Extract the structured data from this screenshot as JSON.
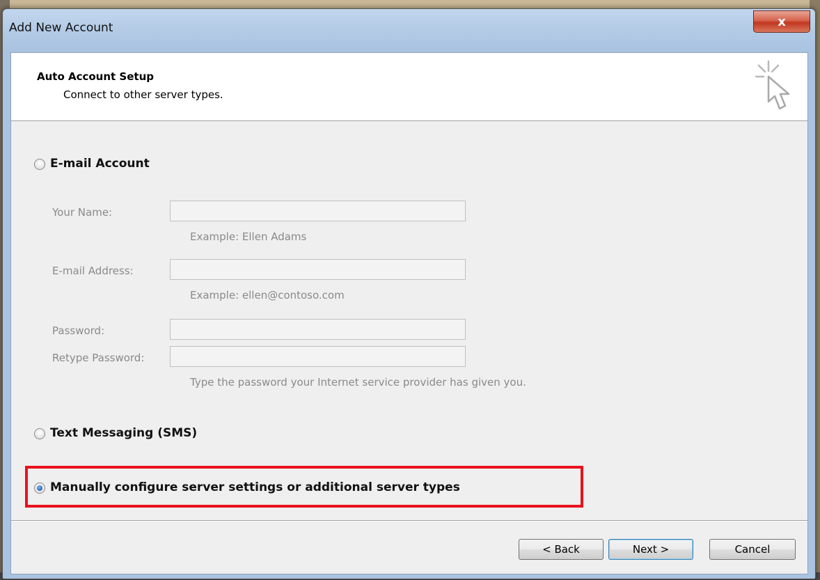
{
  "window": {
    "title": "Add New Account",
    "close_glyph": "x"
  },
  "header": {
    "title": "Auto Account Setup",
    "subtitle": "Connect to other server types.",
    "icon": "wizard-cursor-icon"
  },
  "options": {
    "email_account": {
      "label": "E-mail Account",
      "selected": false
    },
    "sms": {
      "label": "Text Messaging (SMS)",
      "selected": false
    },
    "manual": {
      "label": "Manually configure server settings or additional server types",
      "selected": true
    }
  },
  "form": {
    "name_label": "Your Name:",
    "name_value": "",
    "name_hint": "Example: Ellen Adams",
    "email_label": "E-mail Address:",
    "email_value": "",
    "email_hint": "Example: ellen@contoso.com",
    "password_label": "Password:",
    "password_value": "",
    "retype_label": "Retype Password:",
    "retype_value": "",
    "password_hint": "Type the password your Internet service provider has given you."
  },
  "buttons": {
    "back": "< Back",
    "next": "Next >",
    "cancel": "Cancel"
  },
  "colors": {
    "highlight_border": "#e8121c",
    "close_button": "#c1361f"
  }
}
